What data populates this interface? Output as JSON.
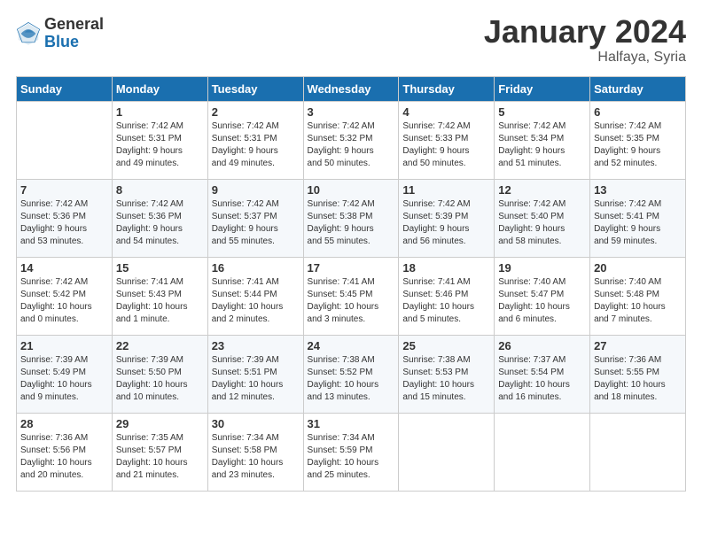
{
  "header": {
    "logo_general": "General",
    "logo_blue": "Blue",
    "month_title": "January 2024",
    "subtitle": "Halfaya, Syria"
  },
  "weekdays": [
    "Sunday",
    "Monday",
    "Tuesday",
    "Wednesday",
    "Thursday",
    "Friday",
    "Saturday"
  ],
  "weeks": [
    [
      {
        "day": "",
        "sunrise": "",
        "sunset": "",
        "daylight": ""
      },
      {
        "day": "1",
        "sunrise": "Sunrise: 7:42 AM",
        "sunset": "Sunset: 5:31 PM",
        "daylight": "Daylight: 9 hours and 49 minutes."
      },
      {
        "day": "2",
        "sunrise": "Sunrise: 7:42 AM",
        "sunset": "Sunset: 5:31 PM",
        "daylight": "Daylight: 9 hours and 49 minutes."
      },
      {
        "day": "3",
        "sunrise": "Sunrise: 7:42 AM",
        "sunset": "Sunset: 5:32 PM",
        "daylight": "Daylight: 9 hours and 50 minutes."
      },
      {
        "day": "4",
        "sunrise": "Sunrise: 7:42 AM",
        "sunset": "Sunset: 5:33 PM",
        "daylight": "Daylight: 9 hours and 50 minutes."
      },
      {
        "day": "5",
        "sunrise": "Sunrise: 7:42 AM",
        "sunset": "Sunset: 5:34 PM",
        "daylight": "Daylight: 9 hours and 51 minutes."
      },
      {
        "day": "6",
        "sunrise": "Sunrise: 7:42 AM",
        "sunset": "Sunset: 5:35 PM",
        "daylight": "Daylight: 9 hours and 52 minutes."
      }
    ],
    [
      {
        "day": "7",
        "sunrise": "Sunrise: 7:42 AM",
        "sunset": "Sunset: 5:36 PM",
        "daylight": "Daylight: 9 hours and 53 minutes."
      },
      {
        "day": "8",
        "sunrise": "Sunrise: 7:42 AM",
        "sunset": "Sunset: 5:36 PM",
        "daylight": "Daylight: 9 hours and 54 minutes."
      },
      {
        "day": "9",
        "sunrise": "Sunrise: 7:42 AM",
        "sunset": "Sunset: 5:37 PM",
        "daylight": "Daylight: 9 hours and 55 minutes."
      },
      {
        "day": "10",
        "sunrise": "Sunrise: 7:42 AM",
        "sunset": "Sunset: 5:38 PM",
        "daylight": "Daylight: 9 hours and 55 minutes."
      },
      {
        "day": "11",
        "sunrise": "Sunrise: 7:42 AM",
        "sunset": "Sunset: 5:39 PM",
        "daylight": "Daylight: 9 hours and 56 minutes."
      },
      {
        "day": "12",
        "sunrise": "Sunrise: 7:42 AM",
        "sunset": "Sunset: 5:40 PM",
        "daylight": "Daylight: 9 hours and 58 minutes."
      },
      {
        "day": "13",
        "sunrise": "Sunrise: 7:42 AM",
        "sunset": "Sunset: 5:41 PM",
        "daylight": "Daylight: 9 hours and 59 minutes."
      }
    ],
    [
      {
        "day": "14",
        "sunrise": "Sunrise: 7:42 AM",
        "sunset": "Sunset: 5:42 PM",
        "daylight": "Daylight: 10 hours and 0 minutes."
      },
      {
        "day": "15",
        "sunrise": "Sunrise: 7:41 AM",
        "sunset": "Sunset: 5:43 PM",
        "daylight": "Daylight: 10 hours and 1 minute."
      },
      {
        "day": "16",
        "sunrise": "Sunrise: 7:41 AM",
        "sunset": "Sunset: 5:44 PM",
        "daylight": "Daylight: 10 hours and 2 minutes."
      },
      {
        "day": "17",
        "sunrise": "Sunrise: 7:41 AM",
        "sunset": "Sunset: 5:45 PM",
        "daylight": "Daylight: 10 hours and 3 minutes."
      },
      {
        "day": "18",
        "sunrise": "Sunrise: 7:41 AM",
        "sunset": "Sunset: 5:46 PM",
        "daylight": "Daylight: 10 hours and 5 minutes."
      },
      {
        "day": "19",
        "sunrise": "Sunrise: 7:40 AM",
        "sunset": "Sunset: 5:47 PM",
        "daylight": "Daylight: 10 hours and 6 minutes."
      },
      {
        "day": "20",
        "sunrise": "Sunrise: 7:40 AM",
        "sunset": "Sunset: 5:48 PM",
        "daylight": "Daylight: 10 hours and 7 minutes."
      }
    ],
    [
      {
        "day": "21",
        "sunrise": "Sunrise: 7:39 AM",
        "sunset": "Sunset: 5:49 PM",
        "daylight": "Daylight: 10 hours and 9 minutes."
      },
      {
        "day": "22",
        "sunrise": "Sunrise: 7:39 AM",
        "sunset": "Sunset: 5:50 PM",
        "daylight": "Daylight: 10 hours and 10 minutes."
      },
      {
        "day": "23",
        "sunrise": "Sunrise: 7:39 AM",
        "sunset": "Sunset: 5:51 PM",
        "daylight": "Daylight: 10 hours and 12 minutes."
      },
      {
        "day": "24",
        "sunrise": "Sunrise: 7:38 AM",
        "sunset": "Sunset: 5:52 PM",
        "daylight": "Daylight: 10 hours and 13 minutes."
      },
      {
        "day": "25",
        "sunrise": "Sunrise: 7:38 AM",
        "sunset": "Sunset: 5:53 PM",
        "daylight": "Daylight: 10 hours and 15 minutes."
      },
      {
        "day": "26",
        "sunrise": "Sunrise: 7:37 AM",
        "sunset": "Sunset: 5:54 PM",
        "daylight": "Daylight: 10 hours and 16 minutes."
      },
      {
        "day": "27",
        "sunrise": "Sunrise: 7:36 AM",
        "sunset": "Sunset: 5:55 PM",
        "daylight": "Daylight: 10 hours and 18 minutes."
      }
    ],
    [
      {
        "day": "28",
        "sunrise": "Sunrise: 7:36 AM",
        "sunset": "Sunset: 5:56 PM",
        "daylight": "Daylight: 10 hours and 20 minutes."
      },
      {
        "day": "29",
        "sunrise": "Sunrise: 7:35 AM",
        "sunset": "Sunset: 5:57 PM",
        "daylight": "Daylight: 10 hours and 21 minutes."
      },
      {
        "day": "30",
        "sunrise": "Sunrise: 7:34 AM",
        "sunset": "Sunset: 5:58 PM",
        "daylight": "Daylight: 10 hours and 23 minutes."
      },
      {
        "day": "31",
        "sunrise": "Sunrise: 7:34 AM",
        "sunset": "Sunset: 5:59 PM",
        "daylight": "Daylight: 10 hours and 25 minutes."
      },
      {
        "day": "",
        "sunrise": "",
        "sunset": "",
        "daylight": ""
      },
      {
        "day": "",
        "sunrise": "",
        "sunset": "",
        "daylight": ""
      },
      {
        "day": "",
        "sunrise": "",
        "sunset": "",
        "daylight": ""
      }
    ]
  ]
}
